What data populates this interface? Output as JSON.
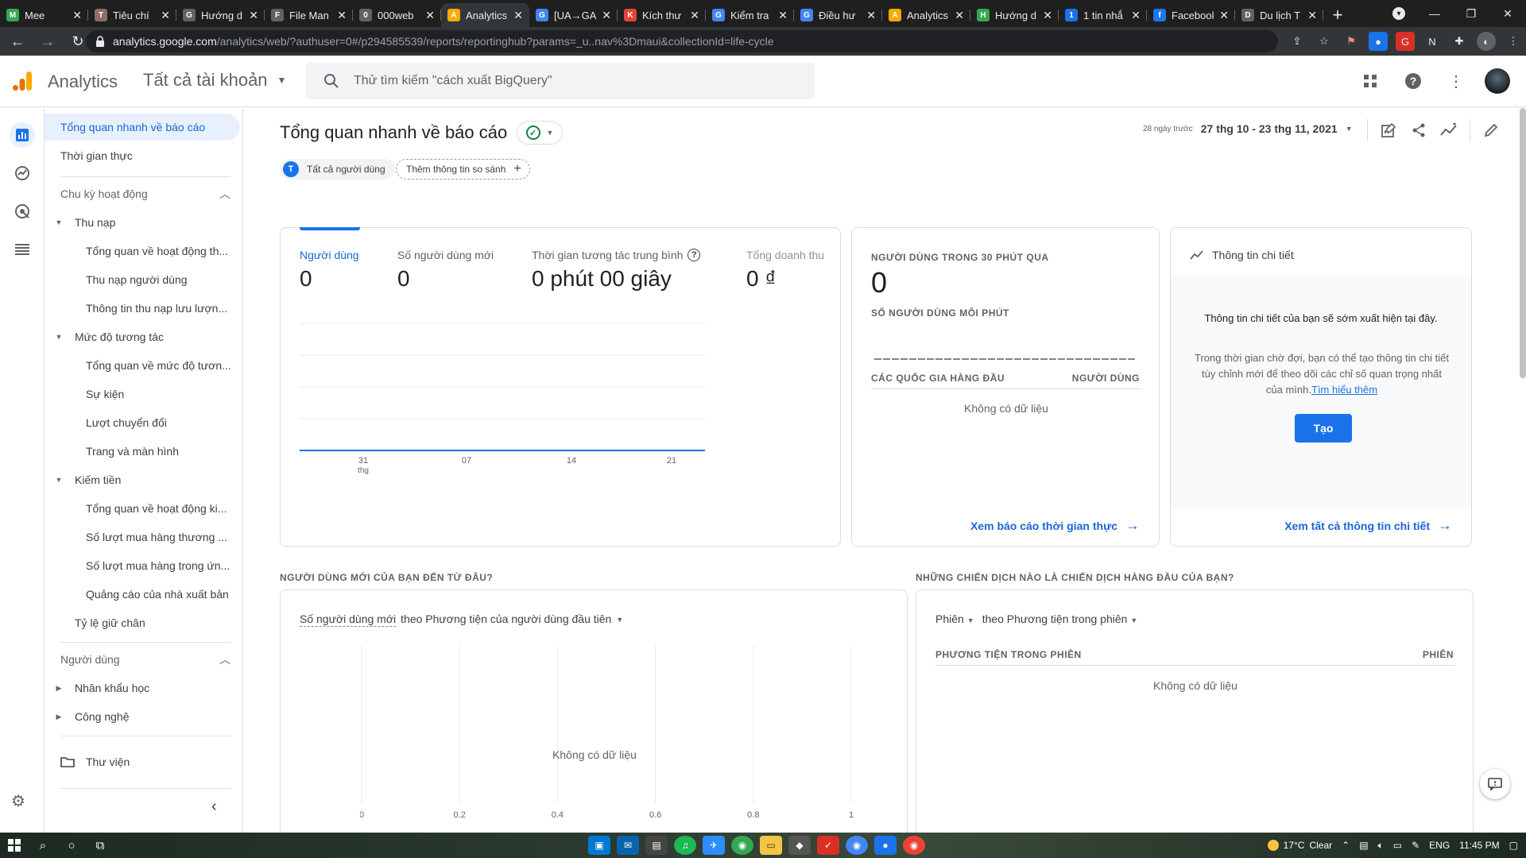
{
  "browser": {
    "tabs": [
      {
        "label": "Mee",
        "fav_color": "#34a853",
        "fav_text": "M"
      },
      {
        "label": "Tiêu chí",
        "fav_color": "#8d6e63",
        "fav_text": "T"
      },
      {
        "label": "Hướng d",
        "fav_color": "#5f6368",
        "fav_text": "G"
      },
      {
        "label": "File Man",
        "fav_color": "#5f6368",
        "fav_text": "F"
      },
      {
        "label": "000web",
        "fav_color": "#5f6368",
        "fav_text": "0"
      },
      {
        "label": "Analytics",
        "fav_color": "#f9ab00",
        "fav_text": "A",
        "active": true
      },
      {
        "label": "[UA→GA",
        "fav_color": "#4285f4",
        "fav_text": "G"
      },
      {
        "label": "Kích thư",
        "fav_color": "#ea4335",
        "fav_text": "K"
      },
      {
        "label": "Kiểm tra",
        "fav_color": "#4285f4",
        "fav_text": "G"
      },
      {
        "label": "Điều hư",
        "fav_color": "#4285f4",
        "fav_text": "G"
      },
      {
        "label": "Analytics",
        "fav_color": "#f9ab00",
        "fav_text": "A"
      },
      {
        "label": "Hướng d",
        "fav_color": "#34a853",
        "fav_text": "H"
      },
      {
        "label": "1 tin nhắ",
        "fav_color": "#1a73e8",
        "fav_text": "1"
      },
      {
        "label": "Facebook",
        "fav_color": "#1877f2",
        "fav_text": "f"
      },
      {
        "label": "Du lịch T",
        "fav_color": "#5f6368",
        "fav_text": "D"
      }
    ],
    "url_host": "analytics.google.com",
    "url_path": "/analytics/web/?authuser=0#/p294585539/reports/reportinghub?params=_u..nav%3Dmaui&collectionId=life-cycle"
  },
  "header": {
    "product": "Analytics",
    "account": "Tất cả tài khoản",
    "search_placeholder": "Thử tìm kiếm \"cách xuất BigQuery\""
  },
  "nav": {
    "top_items": [
      "Tổng quan nhanh về báo cáo",
      "Thời gian thực"
    ],
    "section_lifecycle": "Chu kỳ hoạt động",
    "group_acquisition": "Thu nạp",
    "acquisition_items": [
      "Tổng quan về hoạt động th...",
      "Thu nạp người dùng",
      "Thông tin thu nạp lưu lượn..."
    ],
    "group_engagement": "Mức độ tương tác",
    "engagement_items": [
      "Tổng quan về mức độ tươn...",
      "Sự kiện",
      "Lượt chuyển đổi",
      "Trang và màn hình"
    ],
    "group_monetization": "Kiếm tiền",
    "monetization_items": [
      "Tổng quan về hoạt động ki...",
      "Số lượt mua hàng thương ...",
      "Số lượt mua hàng trong ứn...",
      "Quảng cáo của nhà xuất bản"
    ],
    "retention": "Tỷ lệ giữ chân",
    "section_user": "Người dùng",
    "group_demographics": "Nhân khẩu học",
    "group_tech": "Công nghệ",
    "library": "Thư viện"
  },
  "main": {
    "title": "Tổng quan nhanh về báo cáo",
    "date_prefix": "28 ngày trước",
    "date_range": "27 thg 10 - 23 thg 11, 2021",
    "chip_segment_letter": "T",
    "chip_segment": "Tất cả người dùng",
    "chip_compare": "Thêm thông tin so sánh"
  },
  "overview_card": {
    "metrics": [
      {
        "label": "Người dùng",
        "value": "0"
      },
      {
        "label": "Số người dùng mới",
        "value": "0"
      },
      {
        "label": "Thời gian tương tác trung bình",
        "value": "0 phút 00 giây"
      },
      {
        "label": "Tổng doanh thu",
        "value": "0 ₫"
      }
    ]
  },
  "realtime_card": {
    "title": "NGƯỜI DÙNG TRONG 30 PHÚT QUA",
    "value": "0",
    "per_minute": "SỐ NGƯỜI DÙNG MỖI PHÚT",
    "col_country": "CÁC QUỐC GIA HÀNG ĐẦU",
    "col_users": "NGƯỜI DÙNG",
    "no_data": "Không có dữ liệu",
    "link": "Xem báo cáo thời gian thực"
  },
  "insights_card": {
    "title": "Thông tin chi tiết",
    "heading": "Thông tin chi tiết của bạn sẽ sớm xuất hiện tại đây.",
    "body": "Trong thời gian chờ đợi, bạn có thể tạo thông tin chi tiết tùy chỉnh mới để theo dõi các chỉ số quan trọng nhất của mình.",
    "learn_more": "Tìm hiểu thêm",
    "create_button": "Tạo",
    "link": "Xem tất cả thông tin chi tiết"
  },
  "new_users_section": {
    "heading": "NGƯỜI DÙNG MỚI CỦA BẠN ĐẾN TỪ ĐÂU?",
    "selector_metric": "Số người dùng mới",
    "selector_rest": "theo Phương tiện của người dùng đầu tiên",
    "no_data": "Không có dữ liệu"
  },
  "campaigns_section": {
    "heading": "NHỮNG CHIẾN DỊCH NÀO LÀ CHIẾN DỊCH HÀNG ĐẦU CỦA BẠN?",
    "selector_metric": "Phiên",
    "selector_dim": "theo Phương tiện trong phiên",
    "col_medium": "PHƯƠNG TIỆN TRONG PHIÊN",
    "col_sessions": "PHIÊN",
    "no_data": "Không có dữ liệu"
  },
  "chart_data": [
    {
      "type": "line",
      "x": [
        "31 thg",
        "07",
        "14",
        "21"
      ],
      "xtick_top": [
        "31",
        "07",
        "14",
        "21"
      ],
      "xtick_sub": [
        "thg",
        "",
        "",
        ""
      ],
      "series": [
        {
          "values": [
            0,
            0,
            0,
            0
          ]
        }
      ],
      "line_color": "#1a73e8"
    },
    {
      "type": "bar",
      "xticks": [
        "0",
        "0.2",
        "0.4",
        "0.6",
        "0.8",
        "1"
      ],
      "values": []
    }
  ],
  "taskbar": {
    "weather_temp": "17°C",
    "weather_text": "Clear",
    "lang": "ENG",
    "time": "11:45 PM"
  }
}
